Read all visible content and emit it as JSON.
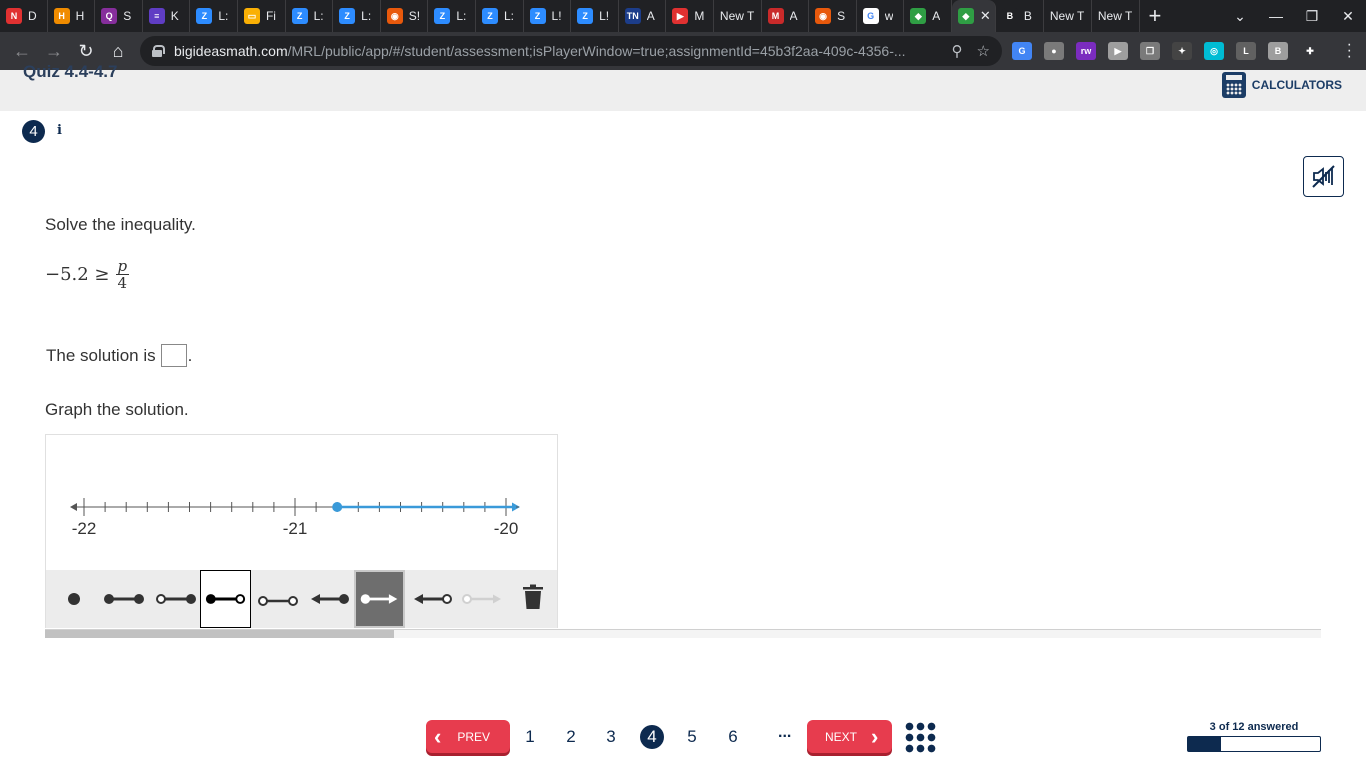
{
  "browser": {
    "tabs": [
      {
        "name": "D",
        "color": "#e03131",
        "glyph": "N"
      },
      {
        "name": "H",
        "color": "#f08c00",
        "glyph": "H"
      },
      {
        "name": "S",
        "color": "#862e9c",
        "glyph": "Q"
      },
      {
        "name": "K",
        "color": "#5f3dc4",
        "glyph": "≡"
      },
      {
        "name": "L:",
        "color": "#2d8cff",
        "glyph": "Z"
      },
      {
        "name": "Fi",
        "color": "#fab005",
        "glyph": "▭"
      },
      {
        "name": "L:",
        "color": "#2d8cff",
        "glyph": "Z"
      },
      {
        "name": "L:",
        "color": "#2d8cff",
        "glyph": "Z"
      },
      {
        "name": "S!",
        "color": "#e8590c",
        "glyph": "◉"
      },
      {
        "name": "L:",
        "color": "#2d8cff",
        "glyph": "Z"
      },
      {
        "name": "L:",
        "color": "#2d8cff",
        "glyph": "Z"
      },
      {
        "name": "L!",
        "color": "#2d8cff",
        "glyph": "Z"
      },
      {
        "name": "L!",
        "color": "#2d8cff",
        "glyph": "Z"
      },
      {
        "name": "A",
        "color": "#1c3d8a",
        "glyph": "TN"
      },
      {
        "name": "M",
        "color": "#e03131",
        "glyph": "▶"
      },
      {
        "name": "New T",
        "color": "",
        "glyph": ""
      },
      {
        "name": "A",
        "color": "#c92a2a",
        "glyph": "M"
      },
      {
        "name": "S",
        "color": "#e8590c",
        "glyph": "◉"
      },
      {
        "name": "w",
        "color": "#ffffff",
        "glyph": "G"
      },
      {
        "name": "A",
        "color": "#2f9e44",
        "glyph": "◆"
      }
    ],
    "active_tab": {
      "color": "#2f9e44",
      "glyph": "◆",
      "close": "✕"
    },
    "after_tabs": [
      {
        "name": "B",
        "color": "#202124",
        "glyph": "B"
      },
      {
        "name": "New T",
        "color": "",
        "glyph": ""
      },
      {
        "name": "New T",
        "color": "",
        "glyph": ""
      }
    ],
    "new_tab_glyph": "+",
    "url_host": "bigideasmath.com",
    "url_path": "/MRL/public/app/#/student/assessment;isPlayerWindow=true;assignmentId=45b3f2aa-409c-4356-...",
    "extensions": [
      {
        "glyph": "G",
        "color": "#4285f4"
      },
      {
        "glyph": "●",
        "color": "#7a7a7a"
      },
      {
        "glyph": "rw",
        "color": "#7b2cbf"
      },
      {
        "glyph": "▶",
        "color": "#9e9e9e"
      },
      {
        "glyph": "❐",
        "color": "#7a7a7a"
      },
      {
        "glyph": "✦",
        "color": "#444444"
      },
      {
        "glyph": "◎",
        "color": "#00bcd4"
      },
      {
        "glyph": "L",
        "color": "#616161"
      },
      {
        "glyph": "B",
        "color": "#9e9e9e"
      },
      {
        "glyph": "✚",
        "color": "#35363a"
      }
    ]
  },
  "header": {
    "quiz_title": "Quiz 4.4-4.7",
    "calculators_label": "CALCULATORS"
  },
  "question": {
    "number": "4",
    "info": "i",
    "prompt": "Solve the inequality.",
    "math_lhs": "−5.2 ≥",
    "math_num": "p",
    "math_den": "4",
    "solution_prefix": "The solution is",
    "solution_suffix": ".",
    "graph_prompt": "Graph the solution."
  },
  "number_line": {
    "min": -22,
    "max": -20,
    "step": 0.1,
    "labels": [
      "-22",
      "-21",
      "-20"
    ],
    "label_values": [
      -22,
      -21,
      -20
    ],
    "plotted_point": -20.8,
    "ray_direction": "right",
    "ray_color": "#3a9ad9",
    "axis_color": "#555555"
  },
  "tools": [
    {
      "id": "point"
    },
    {
      "id": "closed-closed-segment"
    },
    {
      "id": "open-closed-segment"
    },
    {
      "id": "closed-open-segment",
      "selected": true
    },
    {
      "id": "open-open-segment"
    },
    {
      "id": "left-ray-closed"
    },
    {
      "id": "right-ray-closed",
      "active": true
    },
    {
      "id": "left-ray-open"
    },
    {
      "id": "right-ray-open",
      "disabled": true
    },
    {
      "id": "delete"
    }
  ],
  "footer": {
    "prev_label": "PREV",
    "next_label": "NEXT",
    "pages": [
      "1",
      "2",
      "3",
      "4",
      "5",
      "6"
    ],
    "current_page": "4",
    "ellipsis": "...",
    "progress_text": "3 of 12 answered",
    "answered": 3,
    "total": 12
  },
  "colors": {
    "navy": "#0d2a4f",
    "red_button": "#e73c4e"
  }
}
